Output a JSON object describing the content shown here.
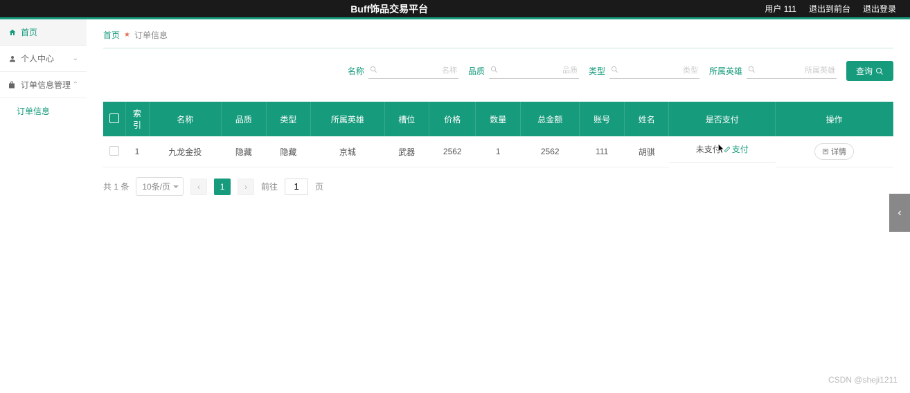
{
  "header": {
    "title": "Buff饰品交易平台",
    "user_label": "用户 111",
    "back_front": "退出到前台",
    "logout": "退出登录"
  },
  "sidebar": {
    "home": "首页",
    "profile": "个人中心",
    "order_mgmt": "订单信息管理",
    "order_info": "订单信息"
  },
  "breadcrumb": {
    "home": "首页",
    "current": "订单信息"
  },
  "search": {
    "name_label": "名称",
    "name_placeholder": "名称",
    "quality_label": "品质",
    "quality_placeholder": "品质",
    "type_label": "类型",
    "type_placeholder": "类型",
    "hero_label": "所属英雄",
    "hero_placeholder": "所属英雄",
    "btn": "查询"
  },
  "table": {
    "headers": {
      "index": "索引",
      "name": "名称",
      "quality": "品质",
      "type": "类型",
      "hero": "所属英雄",
      "slot": "槽位",
      "price": "价格",
      "qty": "数量",
      "total": "总金额",
      "account": "账号",
      "username": "姓名",
      "paid": "是否支付",
      "action": "操作"
    },
    "rows": [
      {
        "index": "1",
        "name": "九龙金投",
        "quality": "隐藏",
        "type": "隐藏",
        "hero": "京城",
        "slot": "武器",
        "price": "2562",
        "qty": "1",
        "total": "2562",
        "account": "111",
        "username": "胡骐",
        "paid_status": "未支付",
        "pay_action": "支付",
        "detail": "详情"
      }
    ]
  },
  "pagination": {
    "total_text": "共 1 条",
    "per_page": "10条/页",
    "current": "1",
    "jump_label": "前往",
    "page_input": "1",
    "page_suffix": "页"
  },
  "watermark": "CSDN @sheji1211"
}
